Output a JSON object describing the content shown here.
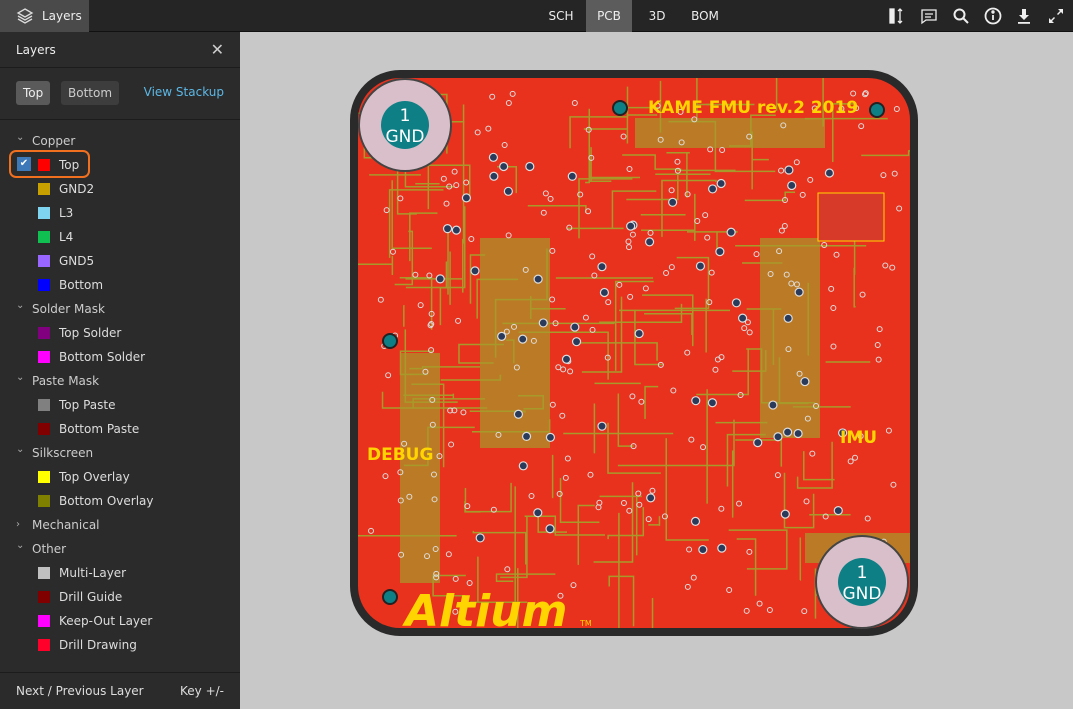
{
  "topbar": {
    "layers_tab": "Layers",
    "views": [
      {
        "label": "SCH"
      },
      {
        "label": "PCB",
        "active": true
      },
      {
        "label": "3D"
      },
      {
        "label": "BOM"
      }
    ],
    "icons": [
      "measure-icon",
      "comment-icon",
      "search-icon",
      "info-icon",
      "download-icon",
      "fullscreen-icon"
    ]
  },
  "panel": {
    "title": "Layers",
    "top_label": "Top",
    "bottom_label": "Bottom",
    "stackup_label": "View Stackup",
    "groups": [
      {
        "label": "Copper",
        "expanded": true,
        "items": [
          {
            "label": "Top",
            "color": "#ff0000",
            "checked": true
          },
          {
            "label": "GND2",
            "color": "#c8a000"
          },
          {
            "label": "L3",
            "color": "#7fd4f0"
          },
          {
            "label": "L4",
            "color": "#10c050"
          },
          {
            "label": "GND5",
            "color": "#9966ff"
          },
          {
            "label": "Bottom",
            "color": "#0000ff"
          }
        ]
      },
      {
        "label": "Solder Mask",
        "expanded": true,
        "items": [
          {
            "label": "Top Solder",
            "color": "#800080"
          },
          {
            "label": "Bottom Solder",
            "color": "#ff00ff"
          }
        ]
      },
      {
        "label": "Paste Mask",
        "expanded": true,
        "items": [
          {
            "label": "Top Paste",
            "color": "#808080"
          },
          {
            "label": "Bottom Paste",
            "color": "#800000"
          }
        ]
      },
      {
        "label": "Silkscreen",
        "expanded": true,
        "items": [
          {
            "label": "Top Overlay",
            "color": "#ffff00"
          },
          {
            "label": "Bottom Overlay",
            "color": "#808000"
          }
        ]
      },
      {
        "label": "Mechanical",
        "expanded": false,
        "items": []
      },
      {
        "label": "Other",
        "expanded": true,
        "items": [
          {
            "label": "Multi-Layer",
            "color": "#c0c0c0"
          },
          {
            "label": "Drill Guide",
            "color": "#800000"
          },
          {
            "label": "Keep-Out Layer",
            "color": "#ff00ff"
          },
          {
            "label": "Drill Drawing",
            "color": "#ff002a"
          }
        ]
      }
    ],
    "footer_left": "Next / Previous Layer",
    "footer_right": "Key +/-"
  },
  "board": {
    "title": "KAME FMU rev.2 2019",
    "debug": "DEBUG",
    "imu": "IMU",
    "logo": "Altium",
    "tm": "TM",
    "pad_num": "1",
    "pad_net": "GND",
    "copper_color": "#e8321e",
    "silk_color": "#ffd400"
  }
}
